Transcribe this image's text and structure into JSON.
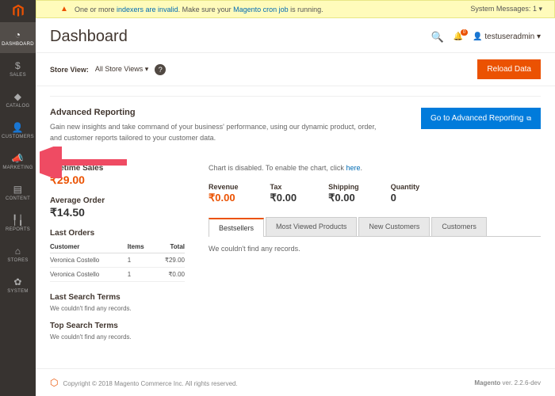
{
  "sysmsg": {
    "text_before": "One or more ",
    "link1": "indexers are invalid",
    "text_mid": ". Make sure your ",
    "link2": "Magento cron job",
    "text_after": " is running.",
    "count_label": "System Messages:",
    "count": "1"
  },
  "header": {
    "title": "Dashboard",
    "notify_count": "0",
    "user": "testuseradmin"
  },
  "nav": [
    {
      "icon": "◔",
      "label": "DASHBOARD"
    },
    {
      "icon": "$",
      "label": "SALES"
    },
    {
      "icon": "◆",
      "label": "CATALOG"
    },
    {
      "icon": "👤",
      "label": "CUSTOMERS"
    },
    {
      "icon": "📣",
      "label": "MARKETING"
    },
    {
      "icon": "▤",
      "label": "CONTENT"
    },
    {
      "icon": "╿╽",
      "label": "REPORTS"
    },
    {
      "icon": "⌂",
      "label": "STORES"
    },
    {
      "icon": "✿",
      "label": "SYSTEM"
    }
  ],
  "toolbar": {
    "store_view_label": "Store View:",
    "store_view_value": "All Store Views",
    "reload": "Reload Data"
  },
  "adv": {
    "title": "Advanced Reporting",
    "desc": "Gain new insights and take command of your business' performance, using our dynamic product, order, and customer reports tailored to your customer data.",
    "button": "Go to Advanced Reporting"
  },
  "lifetime": {
    "label": "Lifetime Sales",
    "value": "₹29.00"
  },
  "average": {
    "label": "Average Order",
    "value": "₹14.50"
  },
  "last_orders": {
    "title": "Last Orders",
    "cols": [
      "Customer",
      "Items",
      "Total"
    ],
    "rows": [
      {
        "c": "Veronica Costello",
        "i": "1",
        "t": "₹29.00"
      },
      {
        "c": "Veronica Costello",
        "i": "1",
        "t": "₹0.00"
      }
    ]
  },
  "last_search": {
    "title": "Last Search Terms",
    "empty": "We couldn't find any records."
  },
  "top_search": {
    "title": "Top Search Terms",
    "empty": "We couldn't find any records."
  },
  "chart_msg": {
    "text": "Chart is disabled. To enable the chart, click ",
    "link": "here"
  },
  "stats": [
    {
      "label": "Revenue",
      "value": "₹0.00",
      "orange": true
    },
    {
      "label": "Tax",
      "value": "₹0.00"
    },
    {
      "label": "Shipping",
      "value": "₹0.00"
    },
    {
      "label": "Quantity",
      "value": "0"
    }
  ],
  "tabs": [
    "Bestsellers",
    "Most Viewed Products",
    "New Customers",
    "Customers"
  ],
  "tab_empty": "We couldn't find any records.",
  "footer": {
    "copy": "Copyright © 2018 Magento Commerce Inc. All rights reserved.",
    "ver_label": "Magento",
    "ver": "ver. 2.2.6-dev"
  },
  "colors": {
    "accent": "#eb5202",
    "blue": "#007bdb"
  }
}
